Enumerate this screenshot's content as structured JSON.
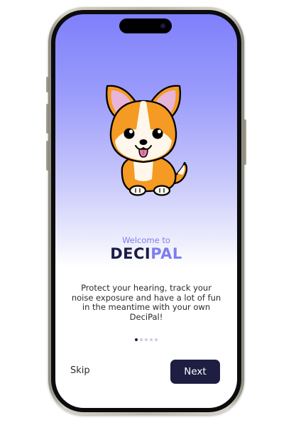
{
  "onboarding": {
    "welcome": "Welcome to",
    "brand_part1": "DECI",
    "brand_part2": "PAL",
    "description": "Protect your hearing, track your noise exposure and have a lot of fun in the meantime with your own DeciPal!",
    "pager": {
      "total": 5,
      "active": 1
    },
    "skip_label": "Skip",
    "next_label": "Next"
  },
  "mascot": {
    "icon": "corgi-puppy-mascot"
  },
  "colors": {
    "gradient_top": "#7f80fb",
    "accent": "#7e7ef0",
    "brand_dark": "#1c1c48",
    "button_bg": "#1e1e42",
    "fur_orange": "#f59a22",
    "ear_inner": "#e7b5d9"
  }
}
